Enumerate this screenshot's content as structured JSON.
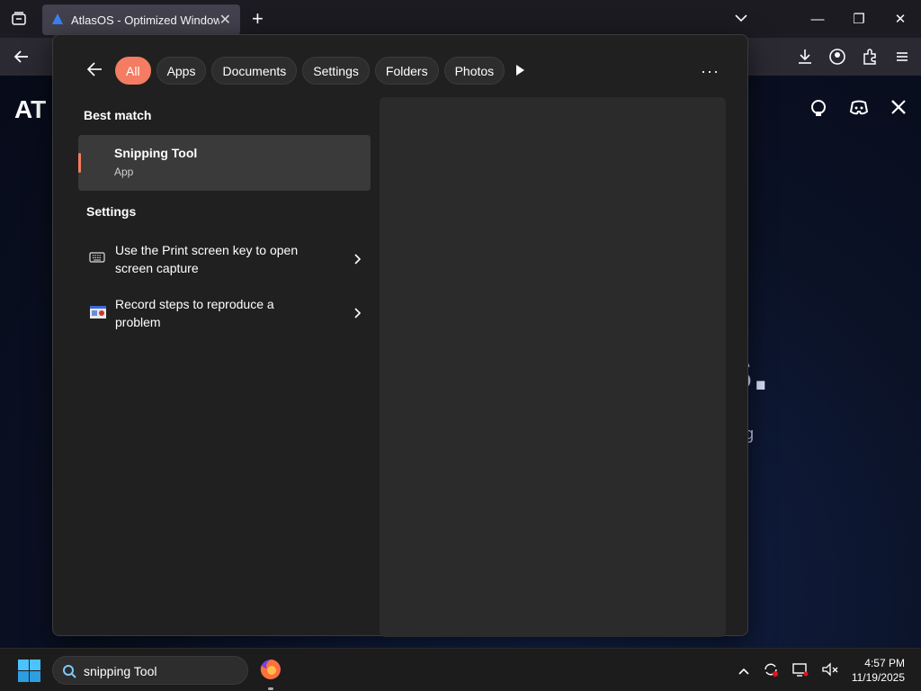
{
  "browser": {
    "tab_title": "AtlasOS - Optimized Windows,",
    "tab_close": "✕",
    "new_tab": "+",
    "window_controls": {
      "minimize": "—",
      "maximize": "❐",
      "close": "✕"
    }
  },
  "page": {
    "logo": "AT",
    "hero_partial": "ts.",
    "sub_partial": "g"
  },
  "search": {
    "filters": [
      "All",
      "Apps",
      "Documents",
      "Settings",
      "Folders",
      "Photos"
    ],
    "active_filter": "All",
    "more": "···",
    "best_match_title": "Best match",
    "best_match": {
      "name": "Snipping Tool",
      "type": "App"
    },
    "settings_title": "Settings",
    "settings_items": [
      {
        "label": "Use the Print screen key to open screen capture",
        "icon": "keyboard-icon"
      },
      {
        "label": "Record steps to reproduce a problem",
        "icon": "steps-recorder-icon"
      }
    ]
  },
  "taskbar": {
    "search_value": "snipping Tool",
    "time": "4:57 PM",
    "date": "11/19/2025"
  },
  "colors": {
    "accent": "#f47c62",
    "flyout_bg": "#202020",
    "preview_bg": "#2b2b2b"
  }
}
